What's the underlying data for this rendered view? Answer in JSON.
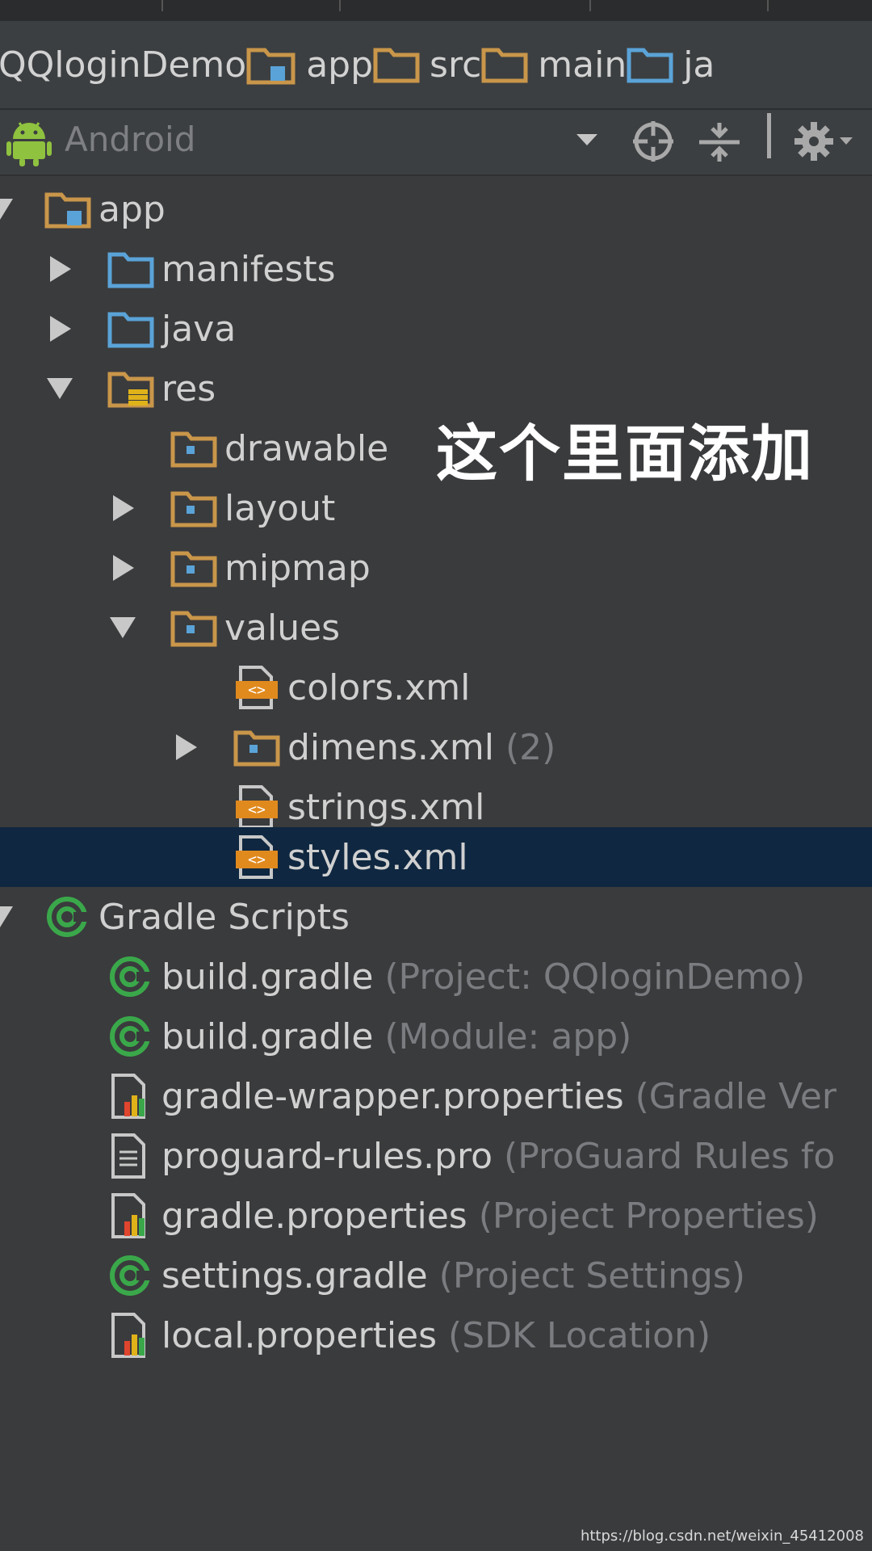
{
  "breadcrumb": {
    "items": [
      "QQloginDemo",
      "app",
      "src",
      "main",
      "ja"
    ]
  },
  "toolbar": {
    "view_mode": "Android"
  },
  "tree": {
    "app": "app",
    "manifests": "manifests",
    "java": "java",
    "res": "res",
    "drawable": "drawable",
    "layout": "layout",
    "mipmap": "mipmap",
    "values": "values",
    "colors": "colors.xml",
    "dimens": "dimens.xml",
    "dimens_count": "(2)",
    "strings": "strings.xml",
    "styles": "styles.xml",
    "gradle_scripts": "Gradle Scripts",
    "files": [
      {
        "name": "build.gradle",
        "hint": "(Project: QQloginDemo)"
      },
      {
        "name": "build.gradle",
        "hint": "(Module: app)"
      },
      {
        "name": "gradle-wrapper.properties",
        "hint": "(Gradle Ver"
      },
      {
        "name": "proguard-rules.pro",
        "hint": "(ProGuard Rules fo"
      },
      {
        "name": "gradle.properties",
        "hint": "(Project Properties)"
      },
      {
        "name": "settings.gradle",
        "hint": "(Project Settings)"
      },
      {
        "name": "local.properties",
        "hint": "(SDK Location)"
      }
    ]
  },
  "annotation": "这个里面添加",
  "watermark": "https://blog.csdn.net/weixin_45412008",
  "colors": {
    "background": "#3a3b3d",
    "selection": "#0f2740",
    "folder_orange": "#c9964a",
    "folder_blue": "#5aa3d8",
    "gradle_green": "#3aa84a"
  }
}
